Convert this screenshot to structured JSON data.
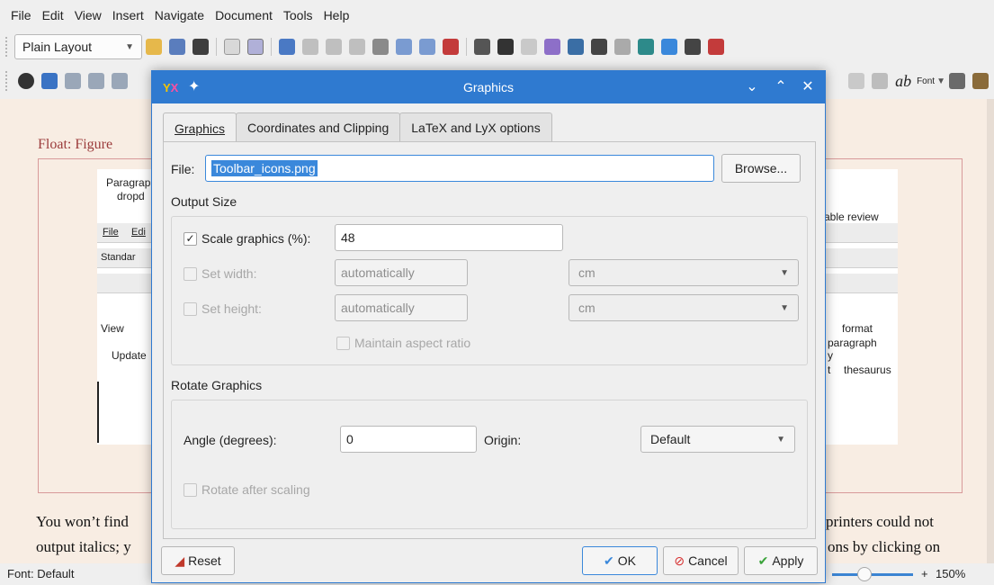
{
  "menu": [
    "File",
    "Edit",
    "View",
    "Insert",
    "Navigate",
    "Document",
    "Tools",
    "Help"
  ],
  "toolbar": {
    "layout_value": "Plain Layout",
    "font_label": "Font",
    "ab_label": "ab"
  },
  "document": {
    "float_label": "Float: Figure",
    "figure": {
      "paragraph_top": "Paragrap",
      "paragraph_bottom": "dropd",
      "menu_file": "File",
      "menu_edit": "Edi",
      "layout_abbrev": "Standar",
      "view_label": "View",
      "update_label": "Update",
      "review_label": "able review",
      "format_label": "format",
      "paragraph_label": "paragraph",
      "thesaurus_label": "thesaurus",
      "y_label": "y",
      "t_label": "t"
    },
    "line1_left": "You won’t find",
    "line1_right": "printers could not",
    "line2_left": "output italics; y",
    "line2_right": "ons by clicking on"
  },
  "status": {
    "font": "Font: Default",
    "zoom_plus": "+",
    "zoom_level": "150%",
    "zoom_fraction": 0.4
  },
  "dialog": {
    "title": "Graphics",
    "tabs": [
      "Graphics",
      "Coordinates and Clipping",
      "LaTeX and LyX options"
    ],
    "file_label": "File:",
    "file_value": "Toolbar_icons.png",
    "browse": "Browse...",
    "output_size": "Output Size",
    "scale_label": "Scale graphics (%):",
    "scale_value": "48",
    "scale_checked": true,
    "set_width": "Set width:",
    "width_placeholder": "automatically",
    "width_unit": "cm",
    "set_height": "Set height:",
    "height_placeholder": "automatically",
    "height_unit": "cm",
    "maintain_aspect": "Maintain aspect ratio",
    "rotate_section": "Rotate Graphics",
    "angle_label": "Angle (degrees):",
    "angle_value": "0",
    "origin_label": "Origin:",
    "origin_value": "Default",
    "rotate_after": "Rotate after scaling",
    "reset": "Reset",
    "ok": "OK",
    "cancel": "Cancel",
    "apply": "Apply"
  },
  "colors": {
    "accent": "#2f7ad0",
    "doc_bg": "#f8ede3",
    "float_border": "#d89a9a"
  }
}
